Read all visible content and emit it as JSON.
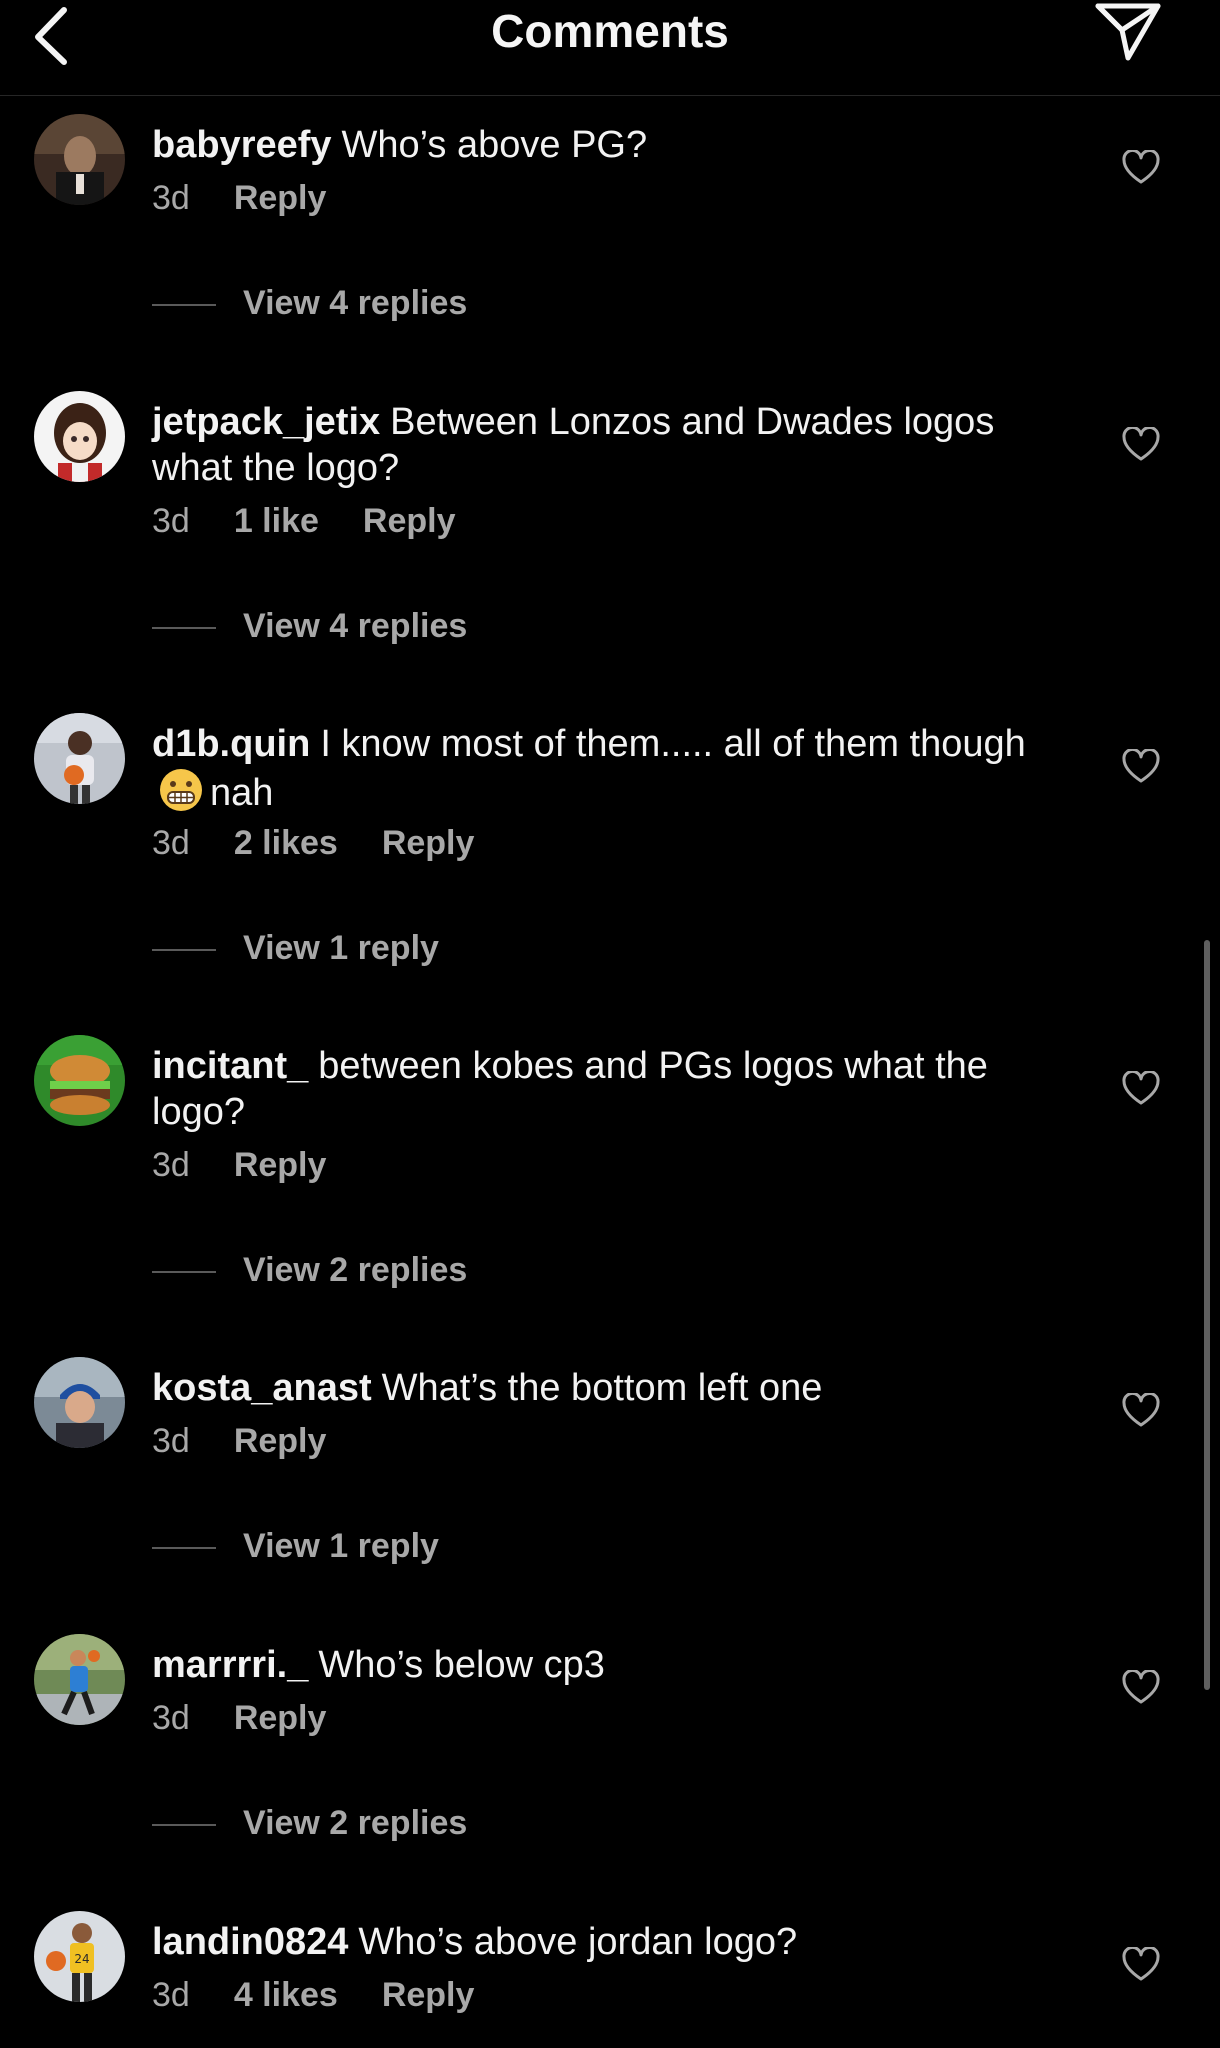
{
  "header": {
    "title": "Comments"
  },
  "comments": [
    {
      "username": "babyreefy",
      "text": "Who’s above PG?",
      "time": "3d",
      "likes": "",
      "reply": "Reply",
      "view_replies": "View 4 replies"
    },
    {
      "username": "jetpack_jetix",
      "text": "Between Lonzos and Dwades logos what the logo?",
      "time": "3d",
      "likes": "1 like",
      "reply": "Reply",
      "view_replies": "View 4 replies"
    },
    {
      "username": "d1b.quin",
      "text_before_emoji": "I know most of them..... all of them though",
      "emoji": "grimacing-face",
      "text_after_emoji": "nah",
      "time": "3d",
      "likes": "2 likes",
      "reply": "Reply",
      "view_replies": "View 1 reply"
    },
    {
      "username": "incitant_",
      "text": "between kobes and PGs logos what the logo?",
      "time": "3d",
      "likes": "",
      "reply": "Reply",
      "view_replies": "View 2 replies"
    },
    {
      "username": "kosta_anast",
      "text": "What’s the bottom left one",
      "time": "3d",
      "likes": "",
      "reply": "Reply",
      "view_replies": "View 1 reply"
    },
    {
      "username": "marrrri._",
      "text": "Who’s below cp3",
      "time": "3d",
      "likes": "",
      "reply": "Reply",
      "view_replies": "View 2 replies"
    },
    {
      "username": "landin0824",
      "text": "Who’s above jordan logo?",
      "time": "3d",
      "likes": "4 likes",
      "reply": "Reply"
    }
  ],
  "icons": {
    "back": "chevron-left-icon",
    "send": "paper-plane-icon",
    "like": "heart-outline-icon"
  },
  "colors": {
    "background": "#000000",
    "primary_text": "#f5f5f5",
    "secondary_text": "#a8a8a8"
  }
}
